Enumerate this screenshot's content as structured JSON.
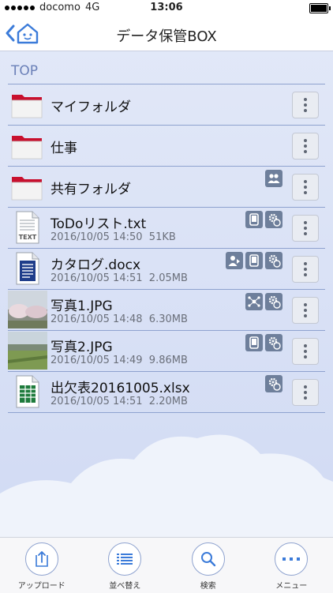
{
  "status": {
    "carrier": "docomo",
    "network": "4G",
    "time": "13:06"
  },
  "nav": {
    "title": "データ保管BOX"
  },
  "section": "TOP",
  "folders": [
    {
      "name": "マイフォルダ"
    },
    {
      "name": "仕事"
    },
    {
      "name": "共有フォルダ"
    }
  ],
  "files": [
    {
      "name": "ToDoリスト.txt",
      "date": "2016/10/05 14:50",
      "size": "51KB"
    },
    {
      "name": "カタログ.docx",
      "date": "2016/10/05 14:51",
      "size": "2.05MB"
    },
    {
      "name": "写真1.JPG",
      "date": "2016/10/05 14:48",
      "size": "6.30MB"
    },
    {
      "name": "写真2.JPG",
      "date": "2016/10/05 14:49",
      "size": "9.86MB"
    },
    {
      "name": "出欠表20161005.xlsx",
      "date": "2016/10/05 14:51",
      "size": "2.20MB"
    }
  ],
  "text_icon_label": "TEXT",
  "tabs": [
    {
      "label": "アップロード",
      "icon": "upload-icon"
    },
    {
      "label": "並べ替え",
      "icon": "sort-icon"
    },
    {
      "label": "検索",
      "icon": "search-icon"
    },
    {
      "label": "メニュー",
      "icon": "menu-icon"
    }
  ],
  "colors": {
    "accent": "#3b7bd9",
    "folder": "#c8102e",
    "badge": "#6e7f9b"
  }
}
